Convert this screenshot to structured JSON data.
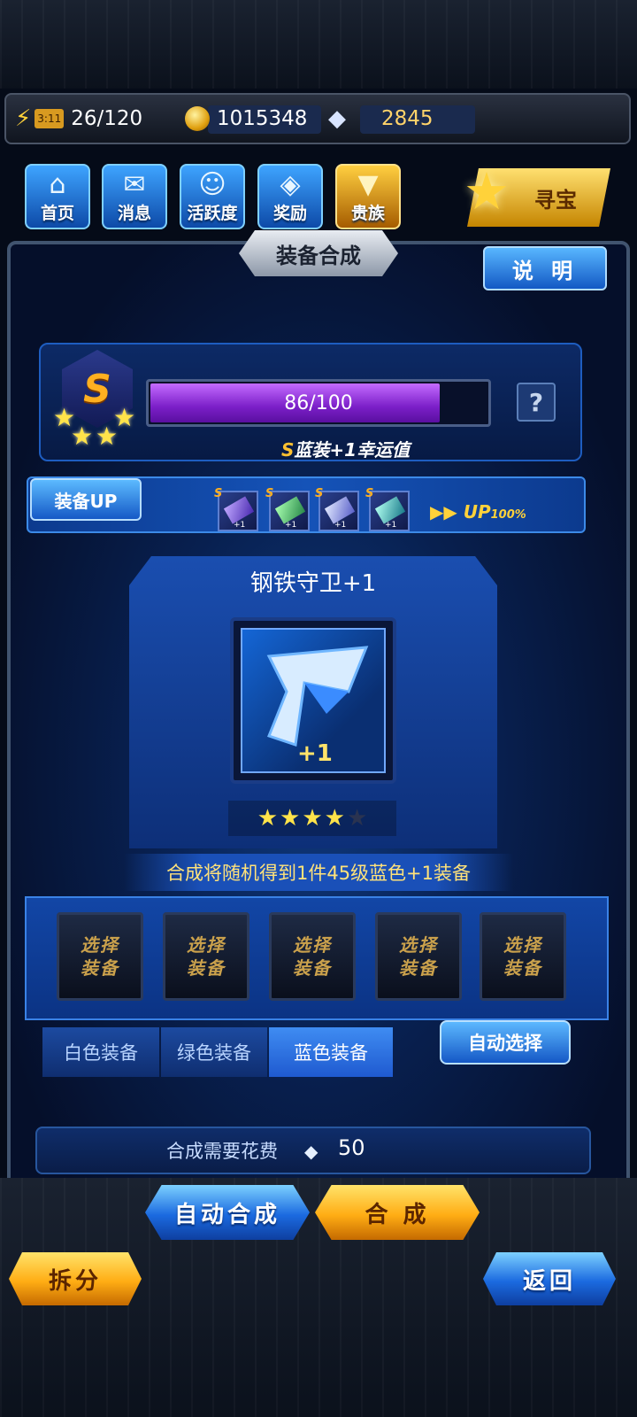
{
  "resources": {
    "stamina_timer": "3:11",
    "stamina": "26/120",
    "gold": "1015348",
    "diamonds": "2845"
  },
  "nav": [
    {
      "label": "首页",
      "icon": "home-icon"
    },
    {
      "label": "消息",
      "icon": "mail-icon"
    },
    {
      "label": "活跃度",
      "icon": "smile-icon"
    },
    {
      "label": "奖励",
      "icon": "gift-icon"
    },
    {
      "label": "贵族",
      "icon": "noble-badge-icon"
    }
  ],
  "treasure_label": "寻宝",
  "panel": {
    "title": "装备合成",
    "help_label": "说 明"
  },
  "luck": {
    "grade": "S",
    "stars": 4,
    "current": 86,
    "max": 100,
    "progress_text": "86/100",
    "note_grade": "S",
    "note_text": "蓝装+1幸运值"
  },
  "equip_up": {
    "label": "装备UP",
    "thumbs": [
      {
        "grade": "S",
        "level": "+1"
      },
      {
        "grade": "S",
        "level": "+1"
      },
      {
        "grade": "S",
        "level": "+1"
      },
      {
        "grade": "S",
        "level": "+1"
      }
    ],
    "up_text": "UP",
    "up_pct": "100%"
  },
  "item": {
    "name": "钢铁守卫+1",
    "plus": "+1",
    "stars_filled": 4,
    "stars_total": 5
  },
  "info_text": "合成将随机得到1件45级蓝色+1装备",
  "slots": [
    {
      "line1": "选择",
      "line2": "装备"
    },
    {
      "line1": "选择",
      "line2": "装备"
    },
    {
      "line1": "选择",
      "line2": "装备"
    },
    {
      "line1": "选择",
      "line2": "装备"
    },
    {
      "line1": "选择",
      "line2": "装备"
    }
  ],
  "tabs": [
    {
      "label": "白色装备",
      "active": false
    },
    {
      "label": "绿色装备",
      "active": false
    },
    {
      "label": "蓝色装备",
      "active": true
    }
  ],
  "auto_select_label": "自动选择",
  "cost": {
    "label": "合成需要花费",
    "value": "50"
  },
  "buttons": {
    "auto_combine": "自动合成",
    "combine": "合 成",
    "split": "拆分",
    "back": "返回"
  },
  "colors": {
    "accent_blue": "#1b6ae0",
    "accent_gold": "#ffad14",
    "progress_purple": "#7b1fc8",
    "star_yellow": "#ffe34a",
    "info_text": "#ffe27a"
  }
}
